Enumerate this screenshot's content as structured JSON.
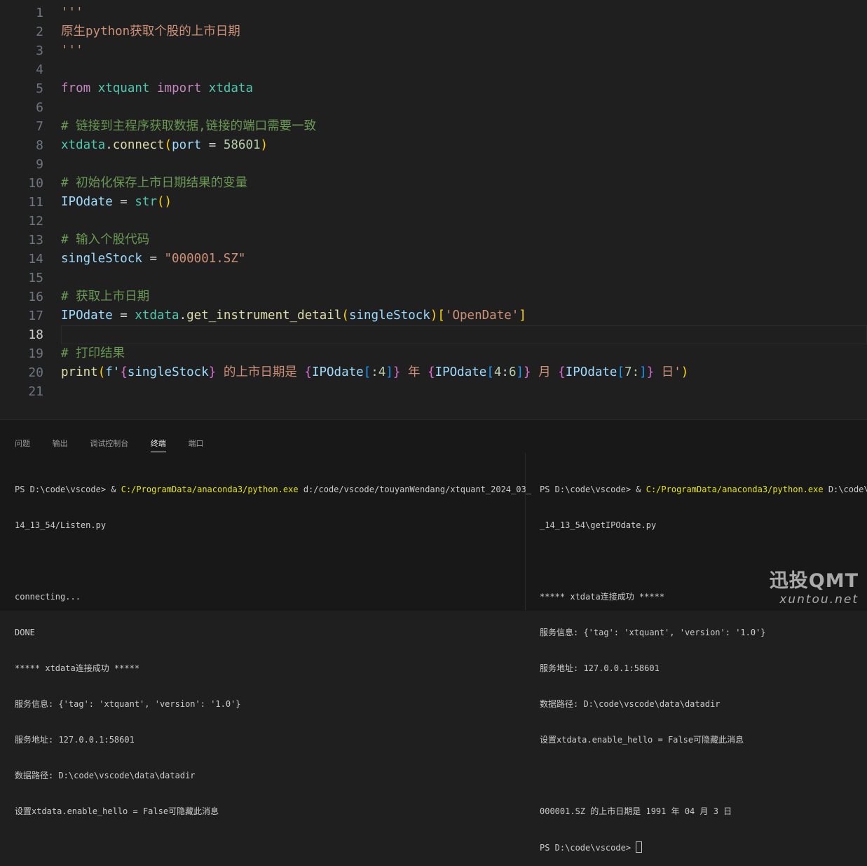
{
  "editor": {
    "active_line": "18",
    "lines": [
      {
        "n": "1"
      },
      {
        "n": "2"
      },
      {
        "n": "3"
      },
      {
        "n": "4"
      },
      {
        "n": "5"
      },
      {
        "n": "6"
      },
      {
        "n": "7"
      },
      {
        "n": "8"
      },
      {
        "n": "9"
      },
      {
        "n": "10"
      },
      {
        "n": "11"
      },
      {
        "n": "12"
      },
      {
        "n": "13"
      },
      {
        "n": "14"
      },
      {
        "n": "15"
      },
      {
        "n": "16"
      },
      {
        "n": "17"
      },
      {
        "n": "18"
      },
      {
        "n": "19"
      },
      {
        "n": "20"
      },
      {
        "n": "21"
      }
    ],
    "code": {
      "l1": "'''",
      "l2": "原生python获取个股的上市日期",
      "l3": "'''",
      "l5_from": "from",
      "l5_mod": "xtquant",
      "l5_import": "import",
      "l5_name": "xtdata",
      "l7": "# 链接到主程序获取数据,链接的端口需要一致",
      "l8_obj": "xtdata",
      "l8_fn": "connect",
      "l8_arg": "port",
      "l8_eq": " = ",
      "l8_val": "58601",
      "l10": "# 初始化保存上市日期结果的变量",
      "l11_var": "IPOdate",
      "l11_fn": "str",
      "l13": "# 输入个股代码",
      "l14_var": "singleStock",
      "l14_val": "\"000001.SZ\"",
      "l16": "# 获取上市日期",
      "l17_var": "IPOdate",
      "l17_obj": "xtdata",
      "l17_fn": "get_instrument_detail",
      "l17_arg": "singleStock",
      "l17_key": "'OpenDate'",
      "l19": "# 打印结果",
      "l20_fn": "print",
      "l20_f": "f'",
      "l20_v1": "singleStock",
      "l20_t1": " 的上市日期是 ",
      "l20_v2": "IPOdate",
      "l20_s2": ":4",
      "l20_t2": " 年 ",
      "l20_v3": "IPOdate",
      "l20_s3a": "4",
      "l20_s3b": "6",
      "l20_t3": " 月 ",
      "l20_v4": "IPOdate",
      "l20_s4": "7:",
      "l20_t4": " 日'"
    }
  },
  "panel": {
    "tabs": [
      "问题",
      "输出",
      "调试控制台",
      "终端",
      "端口"
    ],
    "active_tab": "终端",
    "terminal_left": {
      "prompt": "PS D:\\code\\vscode> & ",
      "exe": "C:/ProgramData/anaconda3/python.exe",
      "script": " d:/code/vscode/touyanWendang/xtquant_2024_03_",
      "script_cont": "14_13_54/Listen.py",
      "lines": [
        "connecting...",
        "DONE",
        "***** xtdata连接成功 *****",
        "服务信息: {'tag': 'xtquant', 'version': '1.0'}",
        "服务地址: 127.0.0.1:58601",
        "数据路径: D:\\code\\vscode\\data\\datadir",
        "设置xtdata.enable_hello = False可隐藏此消息"
      ]
    },
    "terminal_right": {
      "prompt": "PS D:\\code\\vscode> & ",
      "exe": "C:/ProgramData/anaconda3/python.exe",
      "script": " D:\\code\\vs",
      "script_cont": "_14_13_54\\getIPOdate.py",
      "lines": [
        "***** xtdata连接成功 *****",
        "服务信息: {'tag': 'xtquant', 'version': '1.0'}",
        "服务地址: 127.0.0.1:58601",
        "数据路径: D:\\code\\vscode\\data\\datadir",
        "设置xtdata.enable_hello = False可隐藏此消息"
      ],
      "result": "000001.SZ 的上市日期是 1991 年 04 月 3 日",
      "final_prompt": "PS D:\\code\\vscode> "
    }
  },
  "watermark": {
    "main": "迅投QMT",
    "sub": "xuntou.net"
  }
}
